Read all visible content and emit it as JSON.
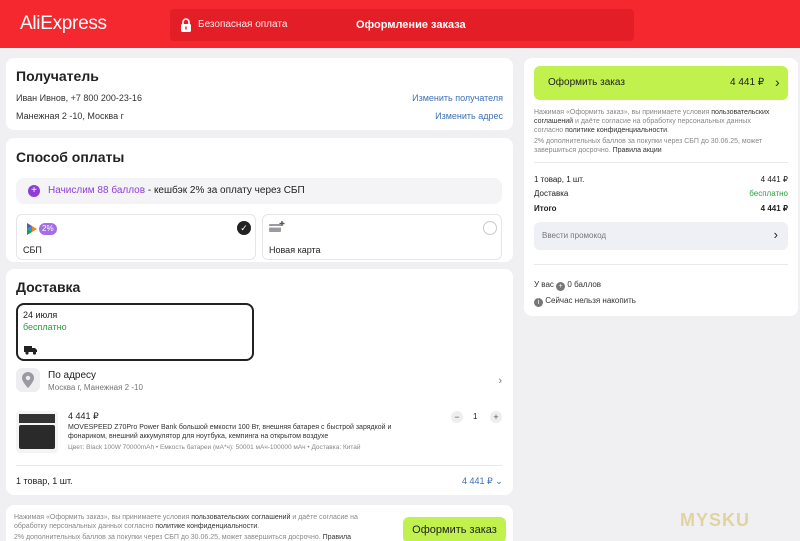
{
  "header": {
    "logo": "AliExpress",
    "secure_label": "Безопасная оплата",
    "title": "Оформление заказа"
  },
  "recipient": {
    "heading": "Получатель",
    "name_phone": "Иван Ивнов, +7 800 200-23-16",
    "address": "Манежная 2 -10, Москва г",
    "change_recipient": "Изменить получателя",
    "change_address": "Изменить адрес"
  },
  "payment": {
    "heading": "Способ оплаты",
    "cashback_highlight": "Начислим 88 баллов",
    "cashback_rest": " - кешбэк 2% за оплату через СБП",
    "sbp_badge": "2%",
    "sbp_label": "СБП",
    "new_card_label": "Новая карта"
  },
  "delivery": {
    "heading": "Доставка",
    "date": "24 июля",
    "price": "бесплатно",
    "method": "По адресу",
    "address": "Москва г, Манежная 2 -10",
    "product_price": "4 441 ₽",
    "product_title_line1": "MOVESPEED Z70Pro Power Bank большой емкости 100 Вт, внешняя батарея с быстрой зарядкой и",
    "product_title_line2": "фонариком, внешний аккумулятор для ноутбука, кемпинга на открытом воздухе",
    "product_specs": "Цвет: Black 100W 70000mAh • Емкость батареи (мА*ч): 50001 мАч-100000 мАч • Доставка: Китай",
    "quantity": "1",
    "summary_left": "1 товар, 1 шт.",
    "summary_right": "4 441 ₽"
  },
  "sidebar": {
    "order_button": "Оформить заказ",
    "order_total": "4 441 ₽",
    "terms_1a": "Нажимая «Оформить заказ», вы принимаете условия ",
    "terms_1b": "пользовательских",
    "terms_2a": "соглашений",
    "terms_2b": " и даёте согласие на обработку персональных данных",
    "terms_3a": "согласно ",
    "terms_3b": "политике конфиденциальности",
    "terms_3c": ".",
    "bonus_1": "2% дополнительных баллов за покупки через СБП до 30.06.25, может",
    "bonus_2a": "завершиться досрочно. ",
    "bonus_2b": "Правила акции",
    "row1_label": "1 товар, 1 шт.",
    "row1_value": "4 441 ₽",
    "row2_label": "Доставка",
    "row2_value": "бесплатно",
    "row3_label": "Итого",
    "row3_value": "4 441 ₽",
    "promo_placeholder": "Ввести промокод",
    "points_prefix": "У вас",
    "points_value": "0 баллов",
    "cannot_save": "Сейчас нельзя накопить"
  },
  "footer": {
    "terms_1a": "Нажимая «Оформить заказ», вы принимаете условия ",
    "terms_1b": "пользовательских соглашений",
    "terms_1c": " и даёте согласие на",
    "terms_2a": "обработку персональных данных согласно ",
    "terms_2b": "политике конфиденциальности",
    "terms_2c": ".",
    "bonus_a": "2% дополнительных баллов за покупки через СБП до 30.06.25, может завершиться досрочно. ",
    "bonus_b": "Правила",
    "order_button": "Оформить заказ"
  },
  "watermark": "MYSKU",
  "colors": {
    "brand_red": "#f5282f",
    "accent_green": "#c0f14c",
    "link_blue": "#3d71b8",
    "purple": "#8e3ed6",
    "free_green": "#2e9b3f"
  }
}
